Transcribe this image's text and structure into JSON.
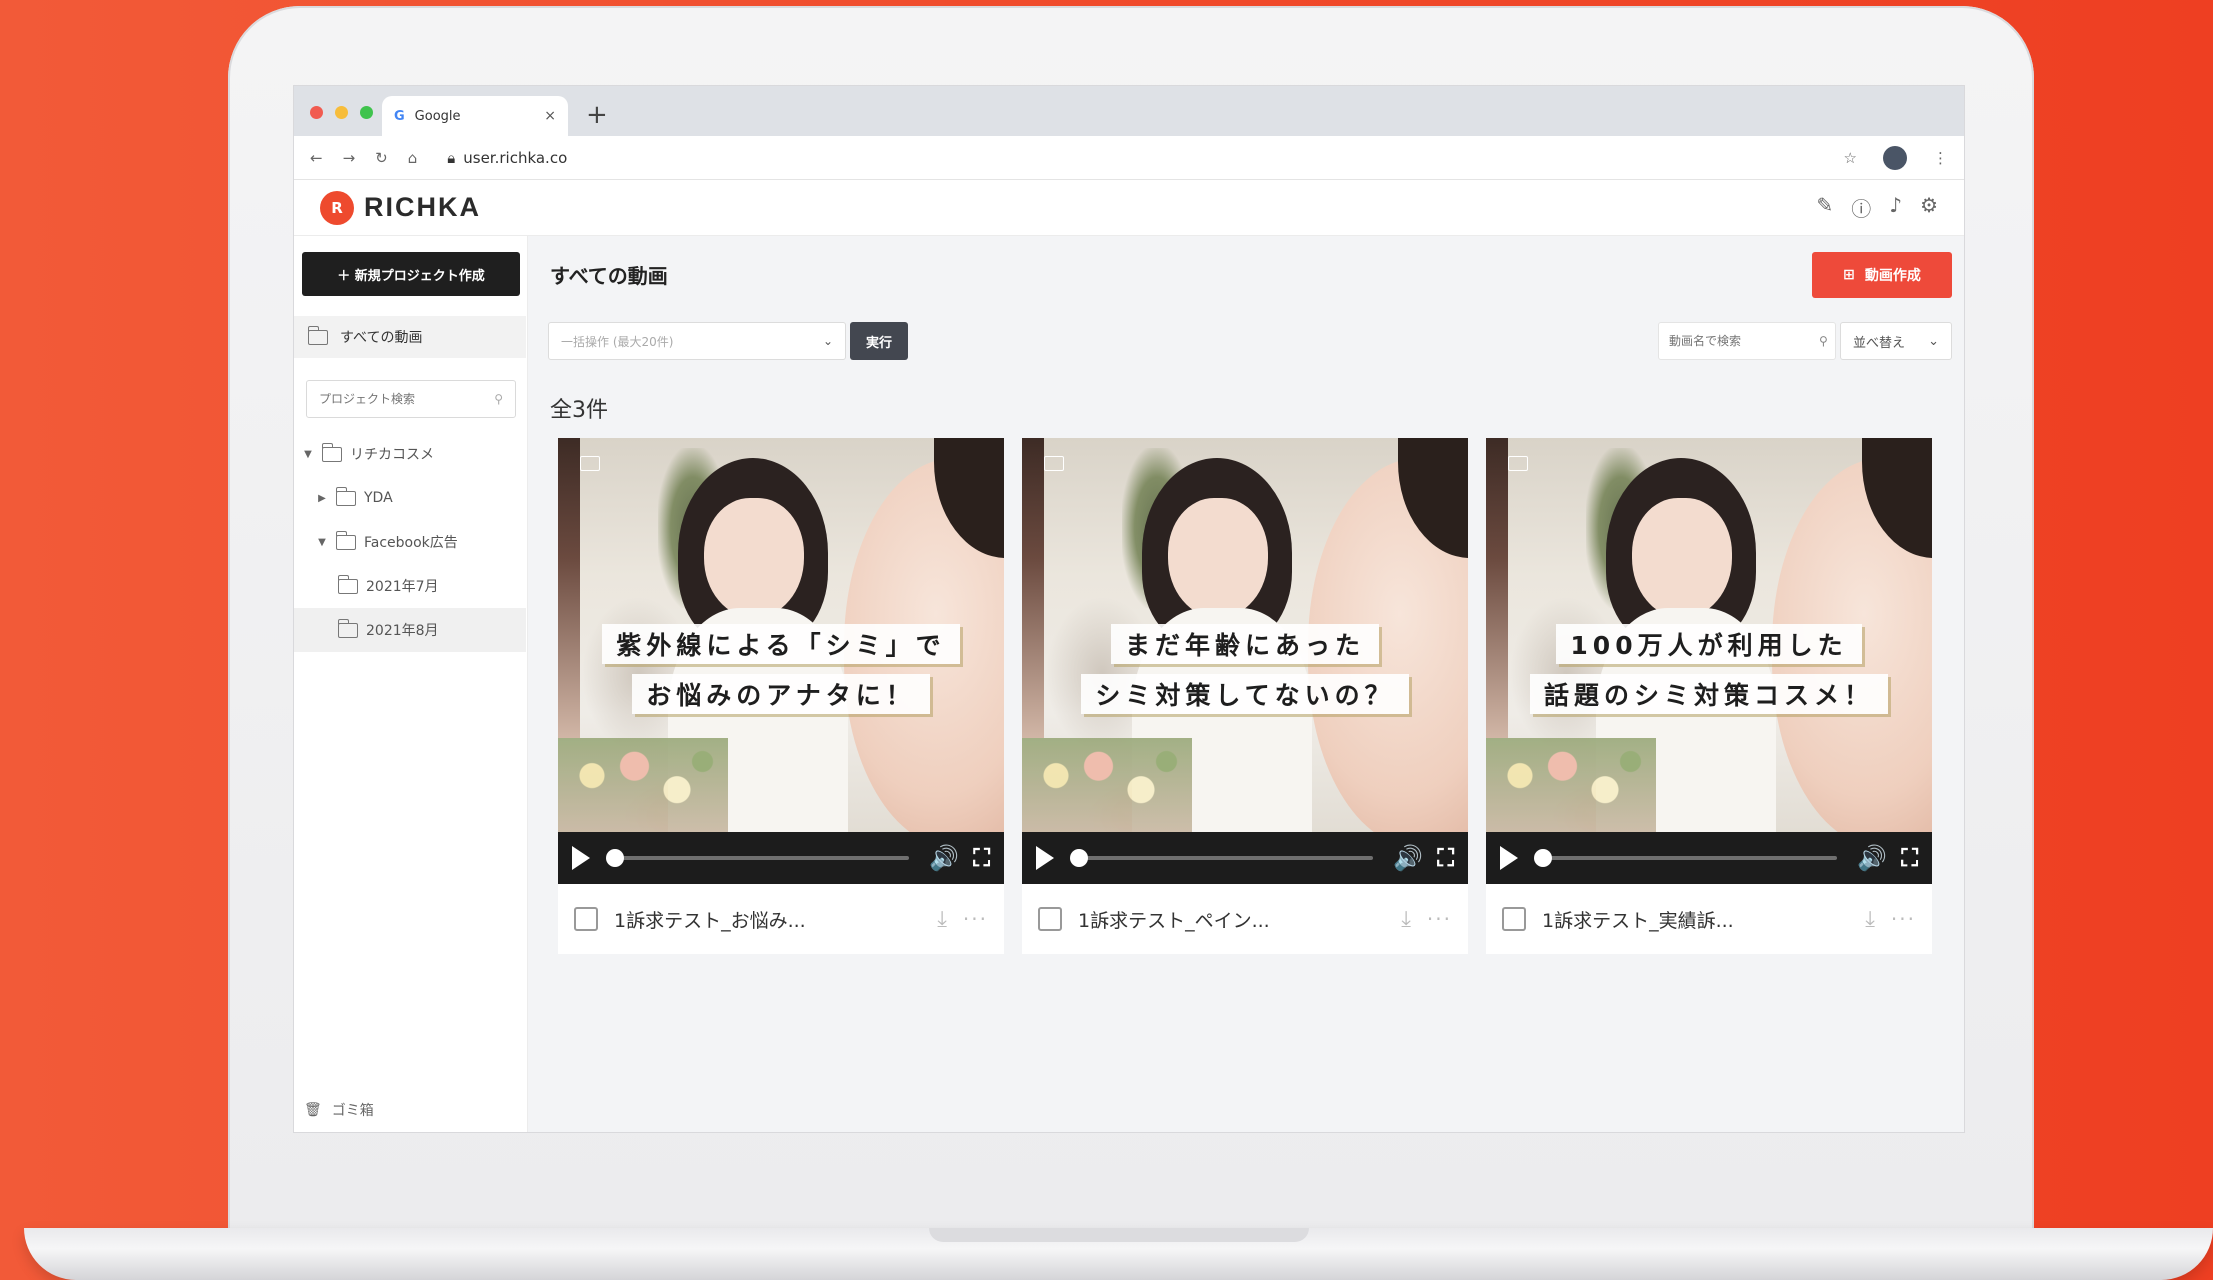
{
  "browser": {
    "tab_icon": "G",
    "tab_title": "Google",
    "tab_close": "×",
    "new_tab": "+",
    "url": "user.richka.co",
    "traffic_colors": [
      "#f15b50",
      "#f7bd3b",
      "#3fc34d"
    ]
  },
  "app": {
    "logo_mark": "R",
    "logo_text": "RICHKA"
  },
  "sidebar": {
    "new_project_label": "＋ 新規プロジェクト作成",
    "all_videos_label": "すべての動画",
    "project_search_placeholder": "プロジェクト検索",
    "tree": [
      {
        "caret": "▼",
        "label": "リチカコスメ",
        "level": 0
      },
      {
        "caret": "▶",
        "label": "YDA",
        "level": 1
      },
      {
        "caret": "▼",
        "label": "Facebook広告",
        "level": 1
      },
      {
        "caret": "",
        "label": "2021年7月",
        "level": 2
      },
      {
        "caret": "",
        "label": "2021年8月",
        "level": 2,
        "selected": true
      }
    ],
    "trash_label": "ゴミ箱"
  },
  "main": {
    "page_title": "すべての動画",
    "create_button_label": "動画作成",
    "bulk_select_placeholder": "一括操作 (最大20件)",
    "run_button_label": "実行",
    "title_search_placeholder": "動画名で検索",
    "sort_label": "並べ替え",
    "count_label": "全3件",
    "accent_color": "#ee4a3a"
  },
  "videos": [
    {
      "caption_line1": "紫外線による「シミ」で",
      "caption_line2": "お悩みのアナタに！",
      "title": "1訴求テスト_お悩み...",
      "progress": 0
    },
    {
      "caption_line1": "まだ年齢にあった",
      "caption_line2": "シミ対策してないの？",
      "title": "1訴求テスト_ペイン...",
      "progress": 0
    },
    {
      "caption_line1": "100万人が利用した",
      "caption_line2": "話題のシミ対策コスメ！",
      "title": "1訴求テスト_実績訴...",
      "progress": 0
    }
  ],
  "icons": {
    "volume": "🔊",
    "fullscreen": "⛶",
    "download": "⤓",
    "more": "···"
  }
}
